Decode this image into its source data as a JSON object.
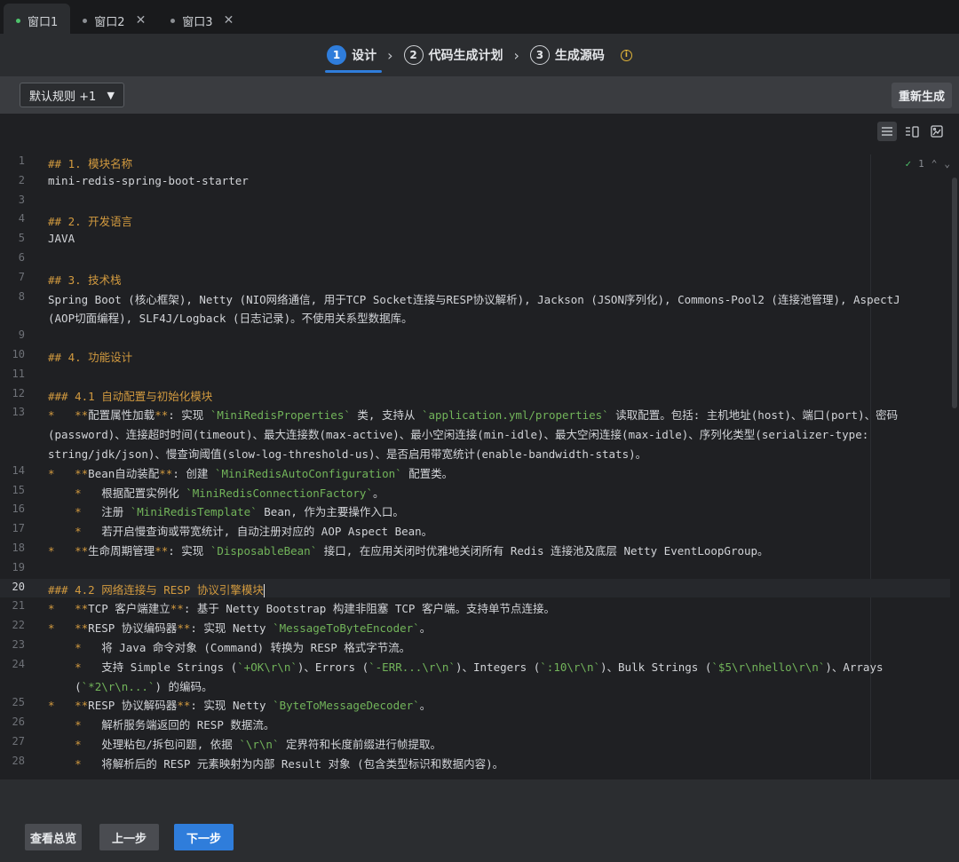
{
  "tabs": [
    {
      "label": "窗口1",
      "active": true
    },
    {
      "label": "窗口2",
      "active": false
    },
    {
      "label": "窗口3",
      "active": false
    }
  ],
  "close_glyph": "✕",
  "stepper": {
    "steps": [
      {
        "num": "1",
        "label": "设计"
      },
      {
        "num": "2",
        "label": "代码生成计划"
      },
      {
        "num": "3",
        "label": "生成源码"
      }
    ],
    "current": 1
  },
  "toolbar": {
    "rule_select": "默认规则 +1",
    "regenerate": "重新生成"
  },
  "editor": {
    "problems_count": "1",
    "current_line": "20",
    "lines": [
      {
        "n": "1",
        "html": "<span class=\"h\">## 1. 模块名称</span>"
      },
      {
        "n": "2",
        "html": "mini-redis-spring-boot-starter"
      },
      {
        "n": "3",
        "html": ""
      },
      {
        "n": "4",
        "html": "<span class=\"h\">## 2. 开发语言</span>"
      },
      {
        "n": "5",
        "html": "JAVA"
      },
      {
        "n": "6",
        "html": ""
      },
      {
        "n": "7",
        "html": "<span class=\"h\">## 3. 技术栈</span>"
      },
      {
        "n": "8",
        "html": "Spring Boot (核心框架), Netty (NIO网络通信, 用于TCP Socket连接与RESP协议解析), Jackson (JSON序列化), Commons-Pool2 (连接池管理), AspectJ"
      },
      {
        "n": "",
        "html": "(AOP切面编程), SLF4J/Logback (日志记录)。不使用关系型数据库。"
      },
      {
        "n": "9",
        "html": ""
      },
      {
        "n": "10",
        "html": "<span class=\"h\">## 4. 功能设计</span>"
      },
      {
        "n": "11",
        "html": ""
      },
      {
        "n": "12",
        "html": "<span class=\"h\">### 4.1 自动配置与初始化模块</span>"
      },
      {
        "n": "13",
        "html": "<span class=\"h\">*</span>   <span class=\"h\">**</span>配置属性加载<span class=\"h\">**</span>: 实现 <span class=\"g\">`MiniRedisProperties`</span> 类, 支持从 <span class=\"g\">`application.yml/properties`</span> 读取配置。包括: 主机地址(host)、端口(port)、密码"
      },
      {
        "n": "",
        "html": "(password)、连接超时时间(timeout)、最大连接数(max-active)、最小空闲连接(min-idle)、最大空闲连接(max-idle)、序列化类型(serializer-type:"
      },
      {
        "n": "",
        "html": "string/jdk/json)、慢查询阈值(slow-log-threshold-us)、是否启用带宽统计(enable-bandwidth-stats)。"
      },
      {
        "n": "14",
        "html": "<span class=\"h\">*</span>   <span class=\"h\">**</span>Bean自动装配<span class=\"h\">**</span>: 创建 <span class=\"g\">`MiniRedisAutoConfiguration`</span> 配置类。"
      },
      {
        "n": "15",
        "html": "    <span class=\"h\">*</span>   根据配置实例化 <span class=\"g\">`MiniRedisConnectionFactory`</span>。"
      },
      {
        "n": "16",
        "html": "    <span class=\"h\">*</span>   注册 <span class=\"g\">`MiniRedisTemplate`</span> Bean, 作为主要操作入口。"
      },
      {
        "n": "17",
        "html": "    <span class=\"h\">*</span>   若开启慢查询或带宽统计, 自动注册对应的 AOP Aspect Bean。"
      },
      {
        "n": "18",
        "html": "<span class=\"h\">*</span>   <span class=\"h\">**</span>生命周期管理<span class=\"h\">**</span>: 实现 <span class=\"g\">`DisposableBean`</span> 接口, 在应用关闭时优雅地关闭所有 Redis 连接池及底层 Netty EventLoopGroup。"
      },
      {
        "n": "19",
        "html": ""
      },
      {
        "n": "20",
        "html": "<span class=\"h\">### 4.2 网络连接与 RESP 协议引擎模块</span><span class=\"caretbar\"></span>"
      },
      {
        "n": "21",
        "html": "<span class=\"h\">*</span>   <span class=\"h\">**</span>TCP 客户端建立<span class=\"h\">**</span>: 基于 Netty Bootstrap 构建非阻塞 TCP 客户端。支持单节点连接。"
      },
      {
        "n": "22",
        "html": "<span class=\"h\">*</span>   <span class=\"h\">**</span>RESP 协议编码器<span class=\"h\">**</span>: 实现 Netty <span class=\"g\">`MessageToByteEncoder`</span>。"
      },
      {
        "n": "23",
        "html": "    <span class=\"h\">*</span>   将 Java 命令对象 (Command) 转换为 RESP 格式字节流。"
      },
      {
        "n": "24",
        "html": "    <span class=\"h\">*</span>   支持 Simple Strings (<span class=\"g\">`+OK\\r\\n`</span>)、Errors (<span class=\"g\">`-ERR...\\r\\n`</span>)、Integers (<span class=\"g\">`:10\\r\\n`</span>)、Bulk Strings (<span class=\"g\">`$5\\r\\nhello\\r\\n`</span>)、Arrays"
      },
      {
        "n": "",
        "html": "    (<span class=\"g\">`*2\\r\\n...`</span>) 的编码。"
      },
      {
        "n": "25",
        "html": "<span class=\"h\">*</span>   <span class=\"h\">**</span>RESP 协议解码器<span class=\"h\">**</span>: 实现 Netty <span class=\"g\">`ByteToMessageDecoder`</span>。"
      },
      {
        "n": "26",
        "html": "    <span class=\"h\">*</span>   解析服务端返回的 RESP 数据流。"
      },
      {
        "n": "27",
        "html": "    <span class=\"h\">*</span>   处理粘包/拆包问题, 依据 <span class=\"g\">`\\r\\n`</span> 定界符和长度前缀进行帧提取。"
      },
      {
        "n": "28",
        "html": "    <span class=\"h\">*</span>   将解析后的 RESP 元素映射为内部 Result 对象 (包含类型标识和数据内容)。"
      }
    ]
  },
  "footer": {
    "overview": "查看总览",
    "prev": "上一步",
    "next": "下一步"
  }
}
